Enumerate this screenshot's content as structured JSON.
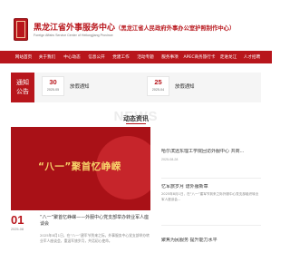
{
  "header": {
    "title": "黑龙江省外事服务中心",
    "subtitle": "（黑龙江省人民政府外事办公室护照制作中心）",
    "english": "Foreign Affairs Service Center of Heilongjiang Province",
    "logo_icon": "seal-logo-icon",
    "accent_color": "#b8161c"
  },
  "nav": {
    "items": [
      "网站首页",
      "关于我们",
      "中心动态",
      "信息公开",
      "党建工作",
      "活动专题",
      "服务事项",
      "APEC商务旅行卡",
      "走进龙江",
      "人才招聘"
    ]
  },
  "notice": {
    "label_line1": "通知",
    "label_line2": "公告",
    "items": [
      {
        "day": "30",
        "ym": "2025-05",
        "title": "放假通知"
      },
      {
        "day": "25",
        "ym": "2025-04",
        "title": "放假通知"
      }
    ]
  },
  "section": {
    "watermark": "NEWS",
    "title": "动态资讯"
  },
  "feature": {
    "image_text": "“八一”聚首忆峥嵘",
    "day": "01",
    "ym": "2025-08",
    "title": "“八一”聚首忆峥嵘——外服中心党支部举办转业军人座谈会",
    "summary": "2025年8月1日，在“八一”建军节到来之际，外事服务中心党支部举办转业军人座谈会，重温军旅岁月，共话初心使命。"
  },
  "news": [
    {
      "title": "哈尔滨远东理工学院回访外服中心 共商...",
      "date": "2025-08-28",
      "summary": ""
    },
    {
      "title": "忆军旅岁月 谱外服新章",
      "date": "",
      "summary": "2025年8月1日，在“八一”建军节到来之际外服中心党支部组织转业军人座谈会..."
    },
    {
      "title": "聚焦为民服务 提升能力水平",
      "date": "",
      "summary": ""
    }
  ]
}
